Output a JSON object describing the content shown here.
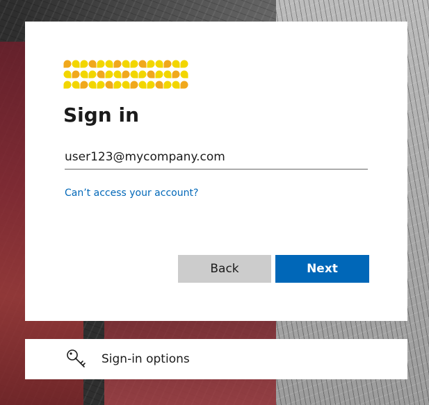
{
  "signin": {
    "title": "Sign in",
    "email_value": "user123@mycompany.com",
    "cant_access_link": "Can’t access your account?",
    "back_label": "Back",
    "next_label": "Next"
  },
  "sign_in_options": {
    "label": "Sign-in options",
    "icon": "key-icon"
  },
  "colors": {
    "primary": "#0067b8",
    "secondary_button": "#cccccc",
    "logo_yellow": "#f2d600",
    "logo_orange": "#f0a81c"
  }
}
